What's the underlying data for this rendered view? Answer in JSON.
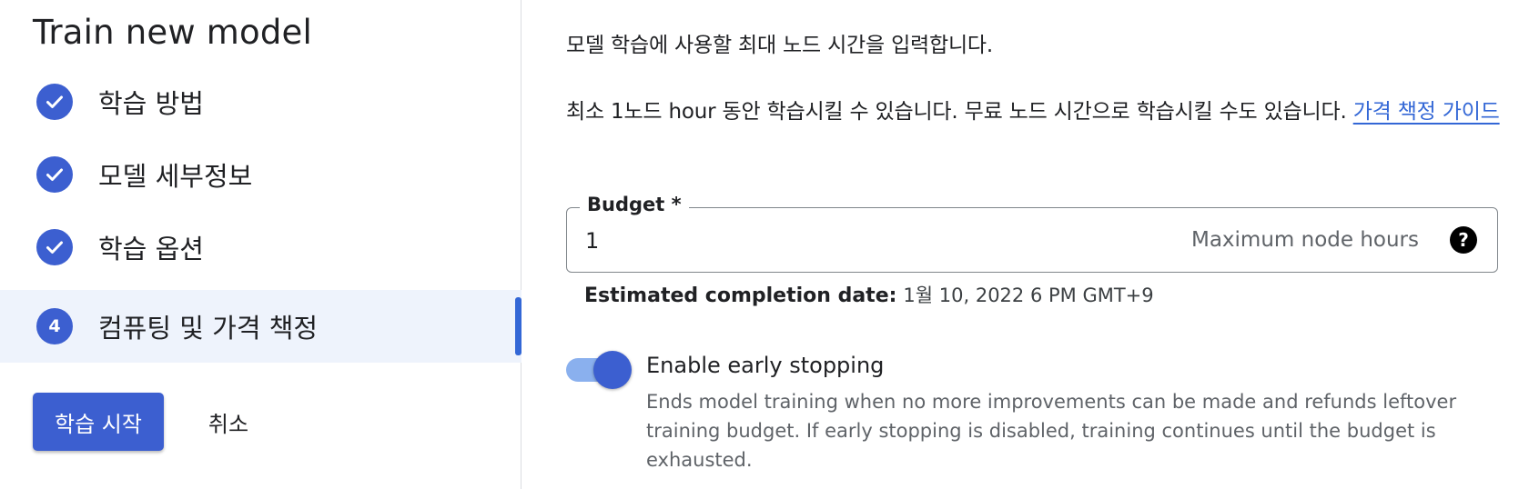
{
  "left_panel": {
    "title": "Train new model",
    "steps": [
      {
        "label": "학습 방법",
        "status": "complete",
        "icon": "check-icon"
      },
      {
        "label": "모델 세부정보",
        "status": "complete",
        "icon": "check-icon"
      },
      {
        "label": "학습 옵션",
        "status": "complete",
        "icon": "check-icon"
      },
      {
        "label": "컴퓨팅 및 가격 책정",
        "status": "active",
        "number": "4"
      }
    ],
    "start_button_label": "학습 시작",
    "cancel_button_label": "취소"
  },
  "right_panel": {
    "intro_text": "모델 학습에 사용할 최대 노드 시간을 입력합니다.",
    "info_text": "최소 1노드 hour 동안 학습시킬 수 있습니다. 무료 노드 시간으로 학습시킬 수도 있습니다.",
    "pricing_link_label": "가격 책정 가이드",
    "budget": {
      "label": "Budget *",
      "value": "1",
      "suffix": "Maximum node hours",
      "help_icon": "help-icon",
      "help_glyph": "?"
    },
    "estimate": {
      "label": "Estimated completion date:",
      "value": "1월 10, 2022 6 PM GMT+9"
    },
    "early_stopping": {
      "label": "Enable early stopping",
      "enabled": true,
      "description": "Ends model training when no more improvements can be made and refunds leftover training budget. If early stopping is disabled, training continues until the budget is exhausted."
    }
  },
  "colors": {
    "primary": "#3c5fd0",
    "link": "#3367d6",
    "active_step_bg": "#eef3fc",
    "toggle_track": "#8ab0ee"
  }
}
